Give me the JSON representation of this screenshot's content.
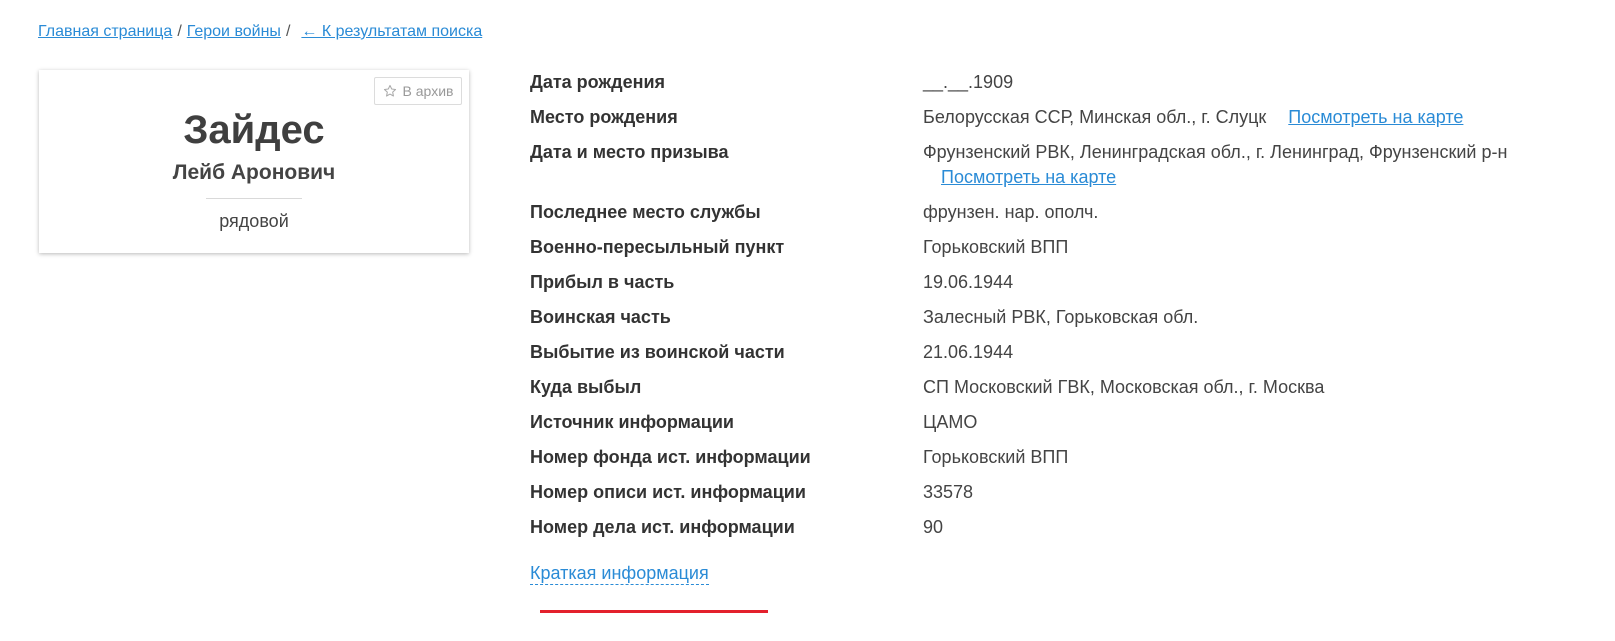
{
  "breadcrumb": {
    "home": "Главная страница",
    "section": "Герои войны",
    "back": "← К результатам поиска",
    "separator": "/"
  },
  "card": {
    "archive_label": "В архив",
    "archive_icon": "star-outline-icon",
    "surname": "Зайдес",
    "given_names": "Лейб Аронович",
    "rank": "рядовой"
  },
  "details": [
    {
      "label": "Дата рождения",
      "value": "__.__.1909"
    },
    {
      "label": "Место рождения",
      "value": "Белорусская ССР, Минская обл., г. Слуцк",
      "map_link": "Посмотреть на карте"
    },
    {
      "label": "Дата и место призыва",
      "value": "Фрунзенский РВК, Ленинградская обл., г. Ленинград, Фрунзенский р-н",
      "map_link": "Посмотреть на карте"
    },
    {
      "label": "Последнее место службы",
      "value": "фрунзен. нар. ополч."
    },
    {
      "label": "Военно-пересыльный пункт",
      "value": "Горьковский ВПП"
    },
    {
      "label": "Прибыл в часть",
      "value": "19.06.1944"
    },
    {
      "label": "Воинская часть",
      "value": "Залесный РВК, Горьковская обл."
    },
    {
      "label": "Выбытие из воинской части",
      "value": "21.06.1944"
    },
    {
      "label": "Куда выбыл",
      "value": "СП Московский ГВК, Московская обл., г. Москва"
    },
    {
      "label": "Источник информации",
      "value": "ЦАМО"
    },
    {
      "label": "Номер фонда ист. информации",
      "value": "Горьковский ВПП"
    },
    {
      "label": "Номер описи ист. информации",
      "value": "33578"
    },
    {
      "label": "Номер дела ист. информации",
      "value": "90"
    }
  ],
  "brief_info_link": "Краткая информация",
  "colors": {
    "link": "#2a8bd6",
    "text": "#444444",
    "label": "#333333",
    "muted": "#999999",
    "accent": "#e3202c"
  }
}
